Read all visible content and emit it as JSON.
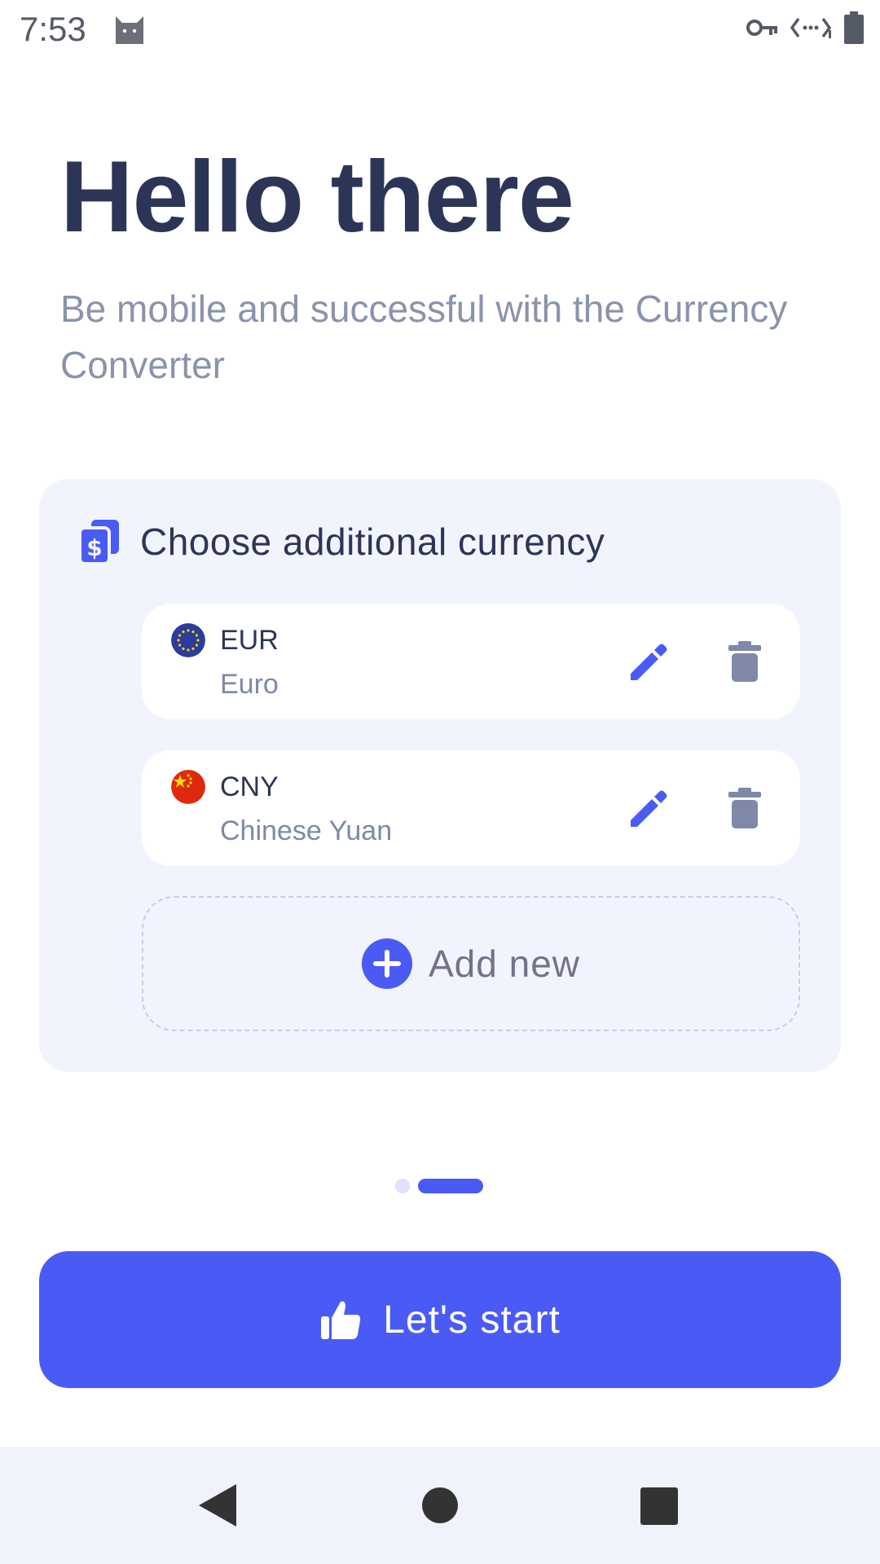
{
  "status_bar": {
    "time": "7:53",
    "icons": [
      "cat-icon",
      "vpn-key-icon",
      "data-sync-icon",
      "battery-icon"
    ]
  },
  "hero": {
    "title": "Hello there",
    "subtitle": "Be mobile and successful with the Currency Converter"
  },
  "card": {
    "title": "Choose additional currency",
    "icon": "currency-notes-icon",
    "currencies": [
      {
        "code": "EUR",
        "name": "Euro",
        "flag": "eu-flag-icon"
      },
      {
        "code": "CNY",
        "name": "Chinese Yuan",
        "flag": "cn-flag-icon"
      }
    ],
    "add_label": "Add new"
  },
  "pager": {
    "pages": 2,
    "active": 2
  },
  "start_button": {
    "label": "Let's start",
    "icon": "thumbs-up-icon"
  },
  "colors": {
    "accent": "#4a5bf5",
    "title": "#2d3557",
    "muted": "#8a93ad",
    "card_bg": "#f2f4fd"
  }
}
